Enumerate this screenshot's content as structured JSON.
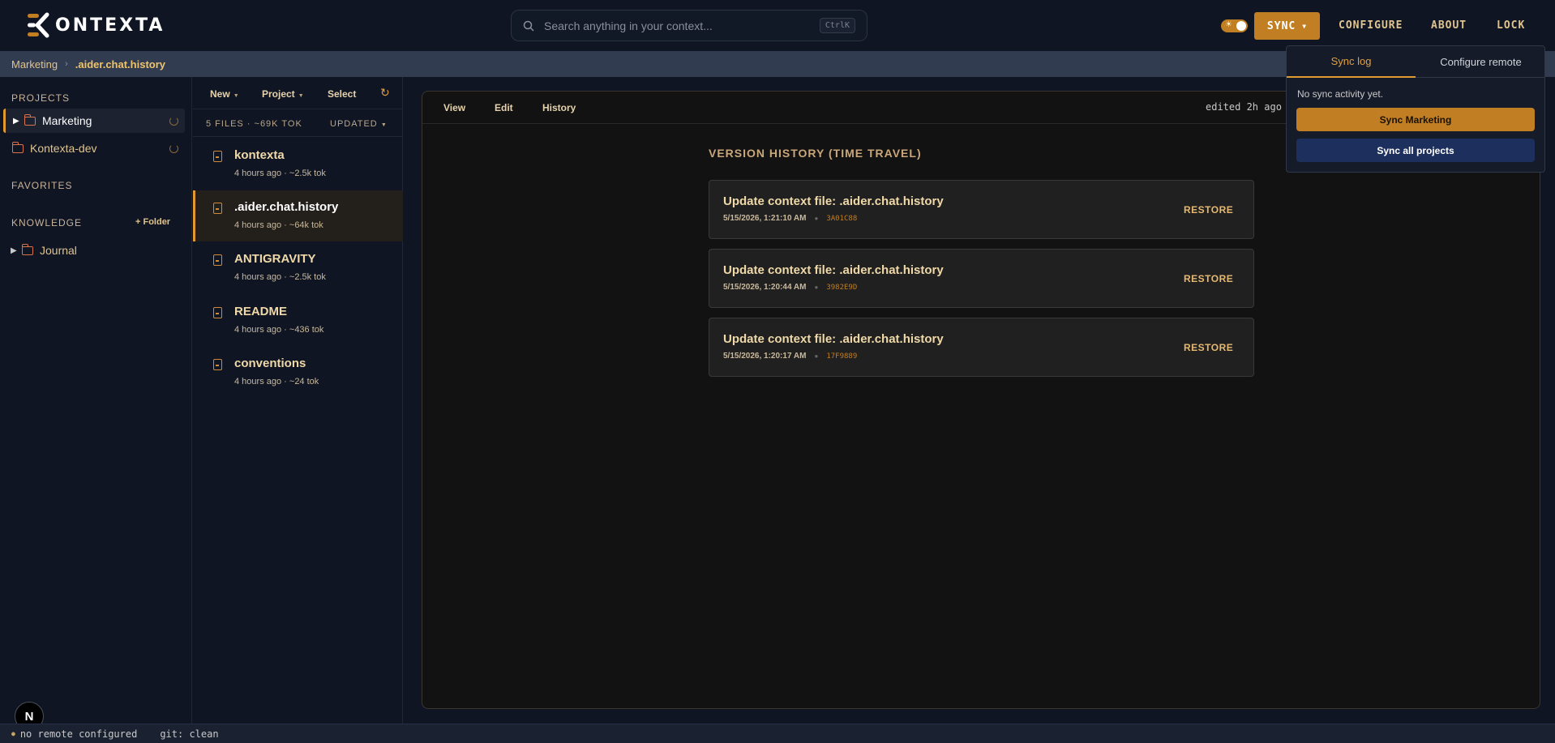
{
  "app": {
    "logo_text": "ONTEXTA",
    "search_placeholder": "Search anything in your context...",
    "search_shortcut": "CtrlK",
    "sync_label": "SYNC",
    "nav": [
      "CONFIGURE",
      "ABOUT",
      "LOCK"
    ]
  },
  "breadcrumb": {
    "project": "Marketing",
    "file": ".aider.chat.history"
  },
  "sidebar": {
    "projects_title": "PROJECTS",
    "projects": [
      {
        "label": "Marketing",
        "active": true
      },
      {
        "label": "Kontexta-dev",
        "active": false
      }
    ],
    "favorites_title": "FAVORITES",
    "knowledge_title": "KNOWLEDGE",
    "add_folder": "+ Folder",
    "knowledge_items": [
      {
        "label": "Journal"
      }
    ],
    "bottom_badge": "N"
  },
  "filelist": {
    "toolbar": {
      "new": "New",
      "project": "Project",
      "select": "Select"
    },
    "count": "5 FILES · ~69K TOK",
    "sort": "UPDATED",
    "files": [
      {
        "name": "kontexta",
        "time": "4 hours ago",
        "tokens": "· ~2.5k tok"
      },
      {
        "name": ".aider.chat.history",
        "time": "4 hours ago",
        "tokens": "· ~64k tok"
      },
      {
        "name": "ANTIGRAVITY",
        "time": "4 hours ago",
        "tokens": "· ~2.5k tok"
      },
      {
        "name": "README",
        "time": "4 hours ago",
        "tokens": "· ~436 tok"
      },
      {
        "name": "conventions",
        "time": "4 hours ago",
        "tokens": "· ~24 tok"
      }
    ]
  },
  "main": {
    "tabs": [
      "View",
      "Edit",
      "History"
    ],
    "edited": "edited 2h ago",
    "history_title": "VERSION HISTORY (TIME TRAVEL)",
    "versions": [
      {
        "title": "Update context file: .aider.chat.history",
        "timestamp": "5/15/2026, 1:21:10 AM",
        "hash": "3A01C88",
        "action": "RESTORE"
      },
      {
        "title": "Update context file: .aider.chat.history",
        "timestamp": "5/15/2026, 1:20:44 AM",
        "hash": "3982E9D",
        "action": "RESTORE"
      },
      {
        "title": "Update context file: .aider.chat.history",
        "timestamp": "5/15/2026, 1:20:17 AM",
        "hash": "17F9889",
        "action": "RESTORE"
      }
    ]
  },
  "sync_dropdown": {
    "tabs": [
      "Sync log",
      "Configure remote"
    ],
    "message": "No sync activity yet.",
    "primary_button": "Sync Marketing",
    "secondary_button": "Sync all projects"
  },
  "statusbar": {
    "remote": "no remote configured",
    "git": "git: clean"
  },
  "colors": {
    "accent": "#c27e22",
    "background": "#0f1523",
    "panel": "#121212",
    "breadcrumb_bar": "#323c50"
  }
}
